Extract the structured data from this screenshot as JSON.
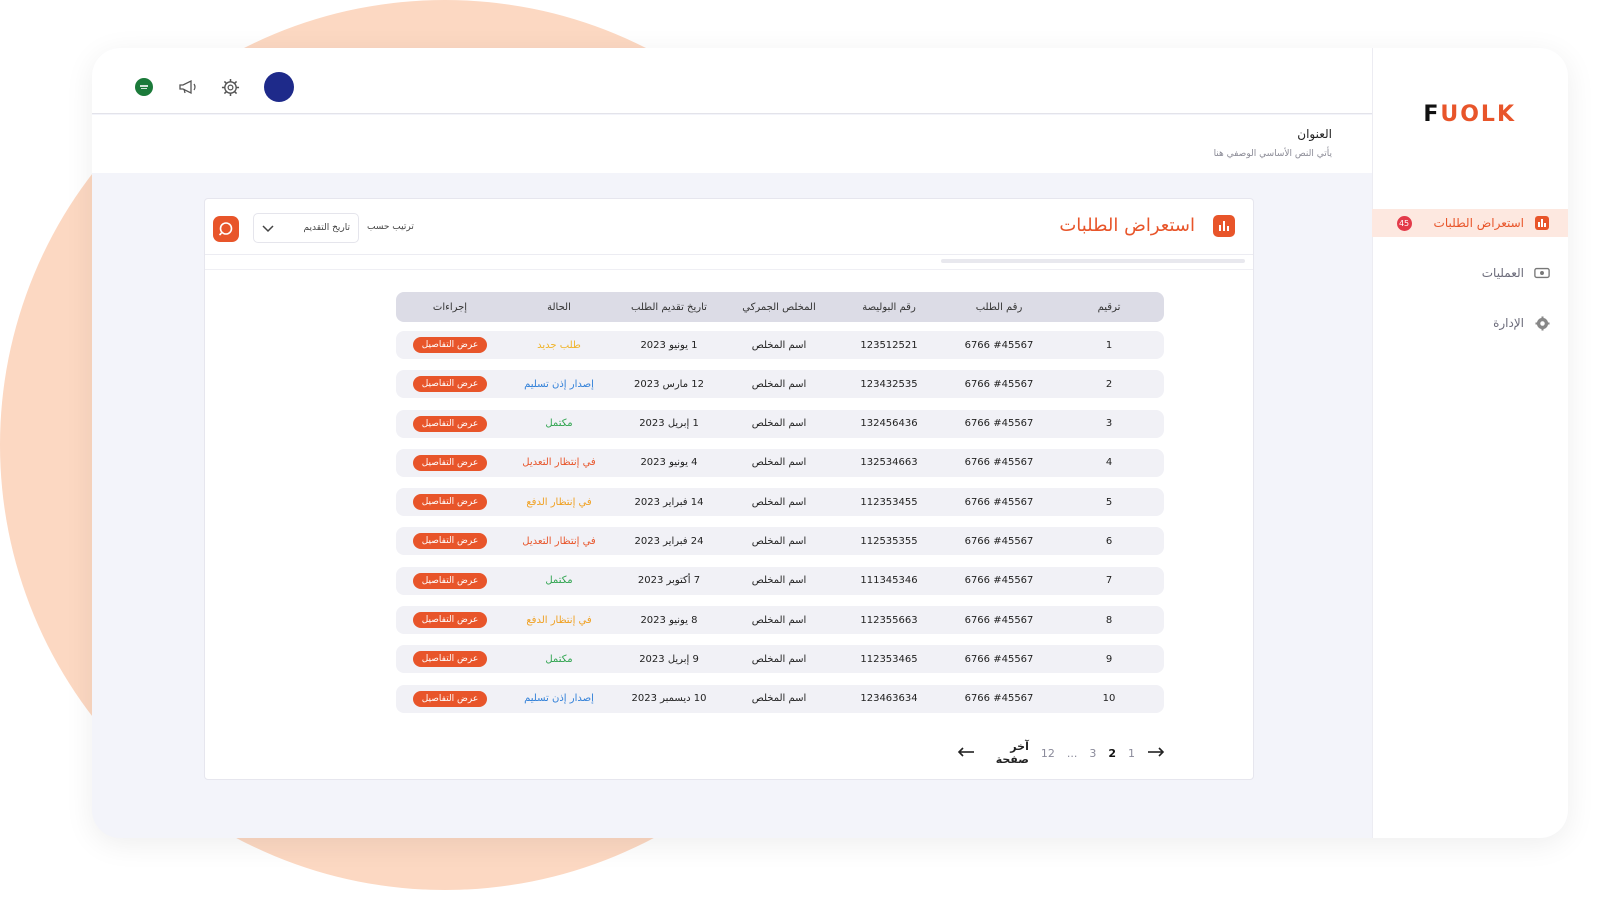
{
  "brand": {
    "logo_first": "F",
    "logo_rest": "UOLK",
    "accent": "#e8552a"
  },
  "sidebar": {
    "items": [
      {
        "label": "استعراض الطلبات",
        "badge": "45",
        "icon": "bar-chart-icon",
        "active": true
      },
      {
        "label": "العمليات",
        "icon": "cash-icon",
        "active": false
      },
      {
        "label": "الإدارة",
        "icon": "gear-icon",
        "active": false
      }
    ]
  },
  "topbar": {
    "icons": [
      "flag-icon",
      "megaphone-icon",
      "gear-icon",
      "avatar"
    ]
  },
  "page": {
    "title": "العنوان",
    "subtitle": "يأتي النص الأساسي الوصفي هنا"
  },
  "card": {
    "title": "استعراض الطلبات",
    "sort_label": "ترتيب حسب",
    "sort_value": "تاريخ التقديم"
  },
  "table": {
    "headers": [
      "ترقيم",
      "رقم الطلب",
      "رقم البوليصة",
      "المخلص الجمركي",
      "تاريخ تقديم الطلب",
      "الحالة",
      "إجراءات"
    ],
    "rows": [
      {
        "n": "1",
        "order": "#45567 6766",
        "policy": "123512521",
        "broker": "اسم المخلص",
        "date": "1 يونيو 2023",
        "status": "طلب جديد",
        "status_color": "#f0b429",
        "action": "عرض التفاصيل"
      },
      {
        "n": "2",
        "order": "#45567 6766",
        "policy": "123432535",
        "broker": "اسم المخلص",
        "date": "12 مارس 2023",
        "status": "إصدار إذن تسليم",
        "status_color": "#2f7fd8",
        "action": "عرض التفاصيل"
      },
      {
        "n": "3",
        "order": "#45567 6766",
        "policy": "132456436",
        "broker": "اسم المخلص",
        "date": "1 إبريل 2023",
        "status": "مكتمل",
        "status_color": "#2fa44f",
        "action": "عرض التفاصيل"
      },
      {
        "n": "4",
        "order": "#45567 6766",
        "policy": "132534663",
        "broker": "اسم المخلص",
        "date": "4 يونيو 2023",
        "status": "في إنتظار التعديل",
        "status_color": "#e8552a",
        "action": "عرض التفاصيل"
      },
      {
        "n": "5",
        "order": "#45567 6766",
        "policy": "112353455",
        "broker": "اسم المخلص",
        "date": "14 فبراير 2023",
        "status": "في إنتظار الدفع",
        "status_color": "#f0a020",
        "action": "عرض التفاصيل"
      },
      {
        "n": "6",
        "order": "#45567 6766",
        "policy": "112535355",
        "broker": "اسم المخلص",
        "date": "24 فبراير 2023",
        "status": "في إنتظار التعديل",
        "status_color": "#e8552a",
        "action": "عرض التفاصيل"
      },
      {
        "n": "7",
        "order": "#45567 6766",
        "policy": "111345346",
        "broker": "اسم المخلص",
        "date": "7 أكتوبر 2023",
        "status": "مكتمل",
        "status_color": "#2fa44f",
        "action": "عرض التفاصيل"
      },
      {
        "n": "8",
        "order": "#45567 6766",
        "policy": "112355663",
        "broker": "اسم المخلص",
        "date": "8 يونيو 2023",
        "status": "في إنتظار الدفع",
        "status_color": "#f0a020",
        "action": "عرض التفاصيل"
      },
      {
        "n": "9",
        "order": "#45567 6766",
        "policy": "112353465",
        "broker": "اسم المخلص",
        "date": "9 إبريل 2023",
        "status": "مكتمل",
        "status_color": "#2fa44f",
        "action": "عرض التفاصيل"
      },
      {
        "n": "10",
        "order": "#45567 6766",
        "policy": "123463634",
        "broker": "اسم المخلص",
        "date": "10 ديسمبر 2023",
        "status": "إصدار إذن تسليم",
        "status_color": "#2f7fd8",
        "action": "عرض التفاصيل"
      }
    ]
  },
  "pagination": {
    "pages": [
      "1",
      "2",
      "3",
      "...",
      "12"
    ],
    "current": "2",
    "last_label": "آخر صفحة"
  }
}
